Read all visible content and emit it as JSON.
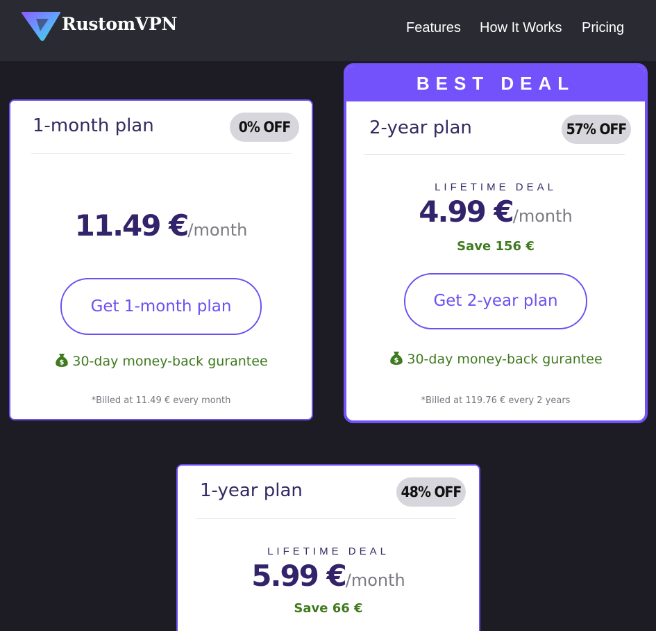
{
  "app": {
    "brand": "RustomVPN",
    "logo_icon": "triangle-play-logo"
  },
  "nav": {
    "items": [
      {
        "label": "Features"
      },
      {
        "label": "How It Works"
      },
      {
        "label": "Pricing"
      }
    ]
  },
  "colors": {
    "background": "#1d1b24",
    "navbar": "#2a2a33",
    "accent": "#7452fb",
    "price": "#33236a",
    "save_green": "#3f7a1f",
    "badge_bg": "#d6d6dc"
  },
  "plans": {
    "one_month": {
      "name": "1-month plan",
      "badge": "0% OFF",
      "price": "11.49 €",
      "per": "/month",
      "cta": "Get 1-month plan",
      "guarantee": "30-day money-back gurantee",
      "guarantee_icon": "money-bag-icon",
      "billed": "*Billed at 11.49 € every month"
    },
    "two_year": {
      "banner": "BEST DEAL",
      "name": "2-year plan",
      "badge": "57% OFF",
      "lifetime": "LIFETIME DEAL",
      "price": "4.99 €",
      "per": "/month",
      "save": "Save 156 €",
      "cta": "Get 2-year plan",
      "guarantee": "30-day money-back gurantee",
      "guarantee_icon": "money-bag-icon",
      "billed": "*Billed at 119.76 € every 2 years"
    },
    "one_year": {
      "name": "1-year plan",
      "badge": "48% OFF",
      "lifetime": "LIFETIME DEAL",
      "price": "5.99 €",
      "per": "/month",
      "save": "Save 66 €"
    }
  }
}
